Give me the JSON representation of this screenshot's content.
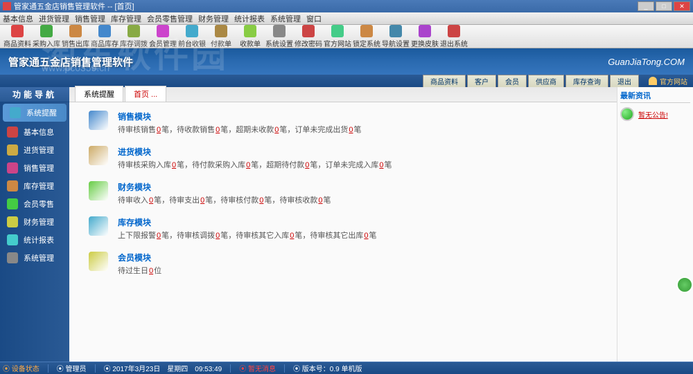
{
  "titlebar": {
    "text": "管家通五金店销售管理软件 -- [首页]"
  },
  "menubar": [
    "基本信息",
    "进货管理",
    "销售管理",
    "库存管理",
    "会员零售管理",
    "财务管理",
    "统计报表",
    "系统管理",
    "窗口"
  ],
  "toolbar": [
    {
      "label": "商品资料",
      "color": "#d44"
    },
    {
      "label": "采购入库",
      "color": "#4a4"
    },
    {
      "label": "销售出库",
      "color": "#c84"
    },
    {
      "label": "商品库存",
      "color": "#48c"
    },
    {
      "label": "库存调拨",
      "color": "#8a4"
    },
    {
      "label": "会员管理",
      "color": "#c4c"
    },
    {
      "label": "前台收银",
      "color": "#4ac"
    },
    {
      "label": "付款单",
      "color": "#a84"
    },
    {
      "label": "收款单",
      "color": "#8c4"
    },
    {
      "label": "系统设置",
      "color": "#888"
    },
    {
      "label": "修改密码",
      "color": "#c44"
    },
    {
      "label": "官方网站",
      "color": "#4c8"
    },
    {
      "label": "锁定系统",
      "color": "#c84"
    },
    {
      "label": "导航设置",
      "color": "#48a"
    },
    {
      "label": "更换皮肤",
      "color": "#a4c"
    },
    {
      "label": "退出系统",
      "color": "#c44"
    }
  ],
  "header": {
    "title": "管家通五金店销售管理软件",
    "brand": "GuanJiaTong.COM",
    "watermark": "淘东软件园",
    "watermark_url": "www.pc0359.cn"
  },
  "quicknav": {
    "buttons": [
      "商品资料",
      "客户",
      "会员",
      "供应商",
      "库存查询",
      "退出"
    ],
    "link": "官方网站"
  },
  "sidebar": {
    "header": "功能导航",
    "items": [
      {
        "label": "系统提醒",
        "color": "#4ac",
        "active": true
      },
      {
        "label": "基本信息",
        "color": "#c44"
      },
      {
        "label": "进货管理",
        "color": "#ca4"
      },
      {
        "label": "销售管理",
        "color": "#c48"
      },
      {
        "label": "库存管理",
        "color": "#c84"
      },
      {
        "label": "会员零售",
        "color": "#4c4"
      },
      {
        "label": "财务管理",
        "color": "#cc4"
      },
      {
        "label": "统计报表",
        "color": "#4cc"
      },
      {
        "label": "系统管理",
        "color": "#888"
      }
    ]
  },
  "tabs": [
    {
      "label": "系统提醒",
      "active": false
    },
    {
      "label": "首页 ...",
      "active": true
    }
  ],
  "modules": [
    {
      "title": "销售模块",
      "color": "#48c",
      "parts": [
        "待审核销售",
        "笔，待收款销售",
        "笔，超期未收款",
        "笔，订单未完成出货",
        "笔"
      ]
    },
    {
      "title": "进货模块",
      "color": "#ca6",
      "parts": [
        "待审核采购入库",
        "笔，待付款采购入库",
        "笔，超期待付款",
        "笔，订单未完成入库",
        "笔"
      ]
    },
    {
      "title": "财务模块",
      "color": "#6c4",
      "parts": [
        "待审收入",
        "笔，待审支出",
        "笔，待审核付款",
        "笔，待审核收款",
        "笔"
      ]
    },
    {
      "title": "库存模块",
      "color": "#4ac",
      "parts": [
        "上下限报警",
        "笔，待审核调拨",
        "笔，待审核其它入库",
        "笔，待审核其它出库",
        "笔"
      ]
    },
    {
      "title": "会员模块",
      "color": "#cc4",
      "parts": [
        "待过生日",
        "位"
      ]
    }
  ],
  "rightpanel": {
    "header": "最新资讯",
    "link": "暂无公告!"
  },
  "statusbar": {
    "items": [
      {
        "label": "设备状态",
        "cls": "warn"
      },
      {
        "label": "管理员",
        "cls": ""
      },
      {
        "label": "2017年3月23日　星期四　09:53:49",
        "cls": ""
      },
      {
        "label": "暂无消息",
        "cls": "alert"
      },
      {
        "label": "版本号：0.9 单机版",
        "cls": ""
      }
    ]
  }
}
